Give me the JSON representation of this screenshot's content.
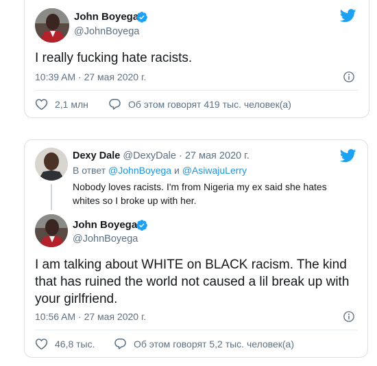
{
  "tweet1": {
    "author": {
      "name": "John Boyega",
      "handle": "@JohnBoyega"
    },
    "text": "I really fucking hate racists.",
    "time": "10:39 AM · 27 мая 2020 г.",
    "likes": "2,1 млн",
    "talking": "Об этом говорят 419 тыс. человек(а)"
  },
  "tweet2": {
    "quoted": {
      "name": "Dexy Dale",
      "handle": "@DexyDale",
      "date": "· 27 мая 2020 г.",
      "reply_prefix": "В ответ",
      "reply_user1": "@JohnBoyega",
      "reply_and": "и",
      "reply_user2": "@AsiwajuLerry",
      "text_line1": "Nobody loves racists. I'm from Nigeria my ex said she hates",
      "text_line2": "whites so I broke up with her."
    },
    "author": {
      "name": "John Boyega",
      "handle": "@JohnBoyega"
    },
    "text_line1": "I am talking about WHITE on BLACK racism. The kind",
    "text_line2": "that has ruined the world not caused a lil break up with",
    "text_line3": "your girlfriend.",
    "time": "10:56 AM · 27 мая 2020 г.",
    "likes": "46,8 тыс.",
    "talking": "Об этом говорят 5,2 тыс. человек(а)"
  },
  "icons": {
    "verified": "verified-badge-icon",
    "bird": "twitter-bird-icon",
    "info": "info-icon",
    "like": "heart-icon",
    "reply": "speech-bubble-icon"
  },
  "colors": {
    "accent": "#1da1f2",
    "link": "#1b95e0",
    "muted": "#5b7083",
    "text": "#14171a"
  }
}
